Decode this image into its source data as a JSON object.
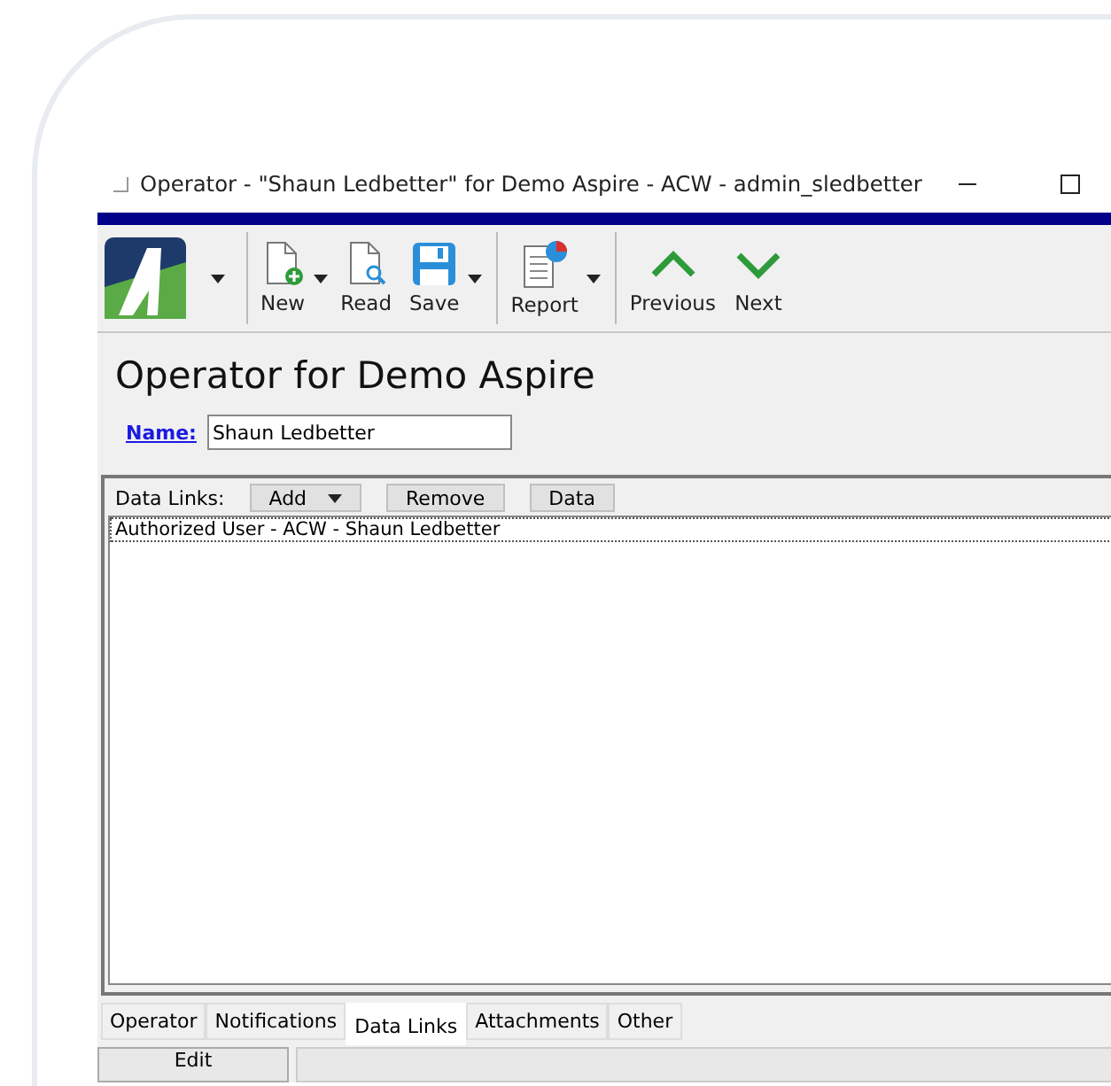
{
  "window": {
    "title": "Operator - \"Shaun Ledbetter\" for Demo Aspire - ACW - admin_sledbetter"
  },
  "toolbar": [
    {
      "kind": "logo",
      "dropdown": true
    },
    {
      "kind": "new",
      "label": "New",
      "dropdown": true
    },
    {
      "kind": "read",
      "label": "Read",
      "dropdown": false
    },
    {
      "kind": "save",
      "label": "Save",
      "dropdown": true
    },
    {
      "kind": "report",
      "label": "Report",
      "dropdown": true
    },
    {
      "kind": "previous",
      "label": "Previous",
      "dropdown": false
    },
    {
      "kind": "next",
      "label": "Next",
      "dropdown": false
    }
  ],
  "heading": "Operator for Demo Aspire",
  "name_field": {
    "label": "Name:",
    "value": "Shaun Ledbetter"
  },
  "data_links": {
    "label": "Data Links:",
    "buttons": [
      {
        "label": "Add",
        "dropdown": true
      },
      {
        "label": "Remove",
        "dropdown": false
      },
      {
        "label": "Data",
        "dropdown": false
      }
    ],
    "items": [
      "Authorized User - ACW - Shaun Ledbetter"
    ]
  },
  "tabs": [
    {
      "label": "Operator",
      "selected": false
    },
    {
      "label": "Notifications",
      "selected": false
    },
    {
      "label": "Data Links",
      "selected": true
    },
    {
      "label": "Attachments",
      "selected": false
    },
    {
      "label": "Other",
      "selected": false
    }
  ],
  "bottom_buttons": [
    "Edit"
  ]
}
